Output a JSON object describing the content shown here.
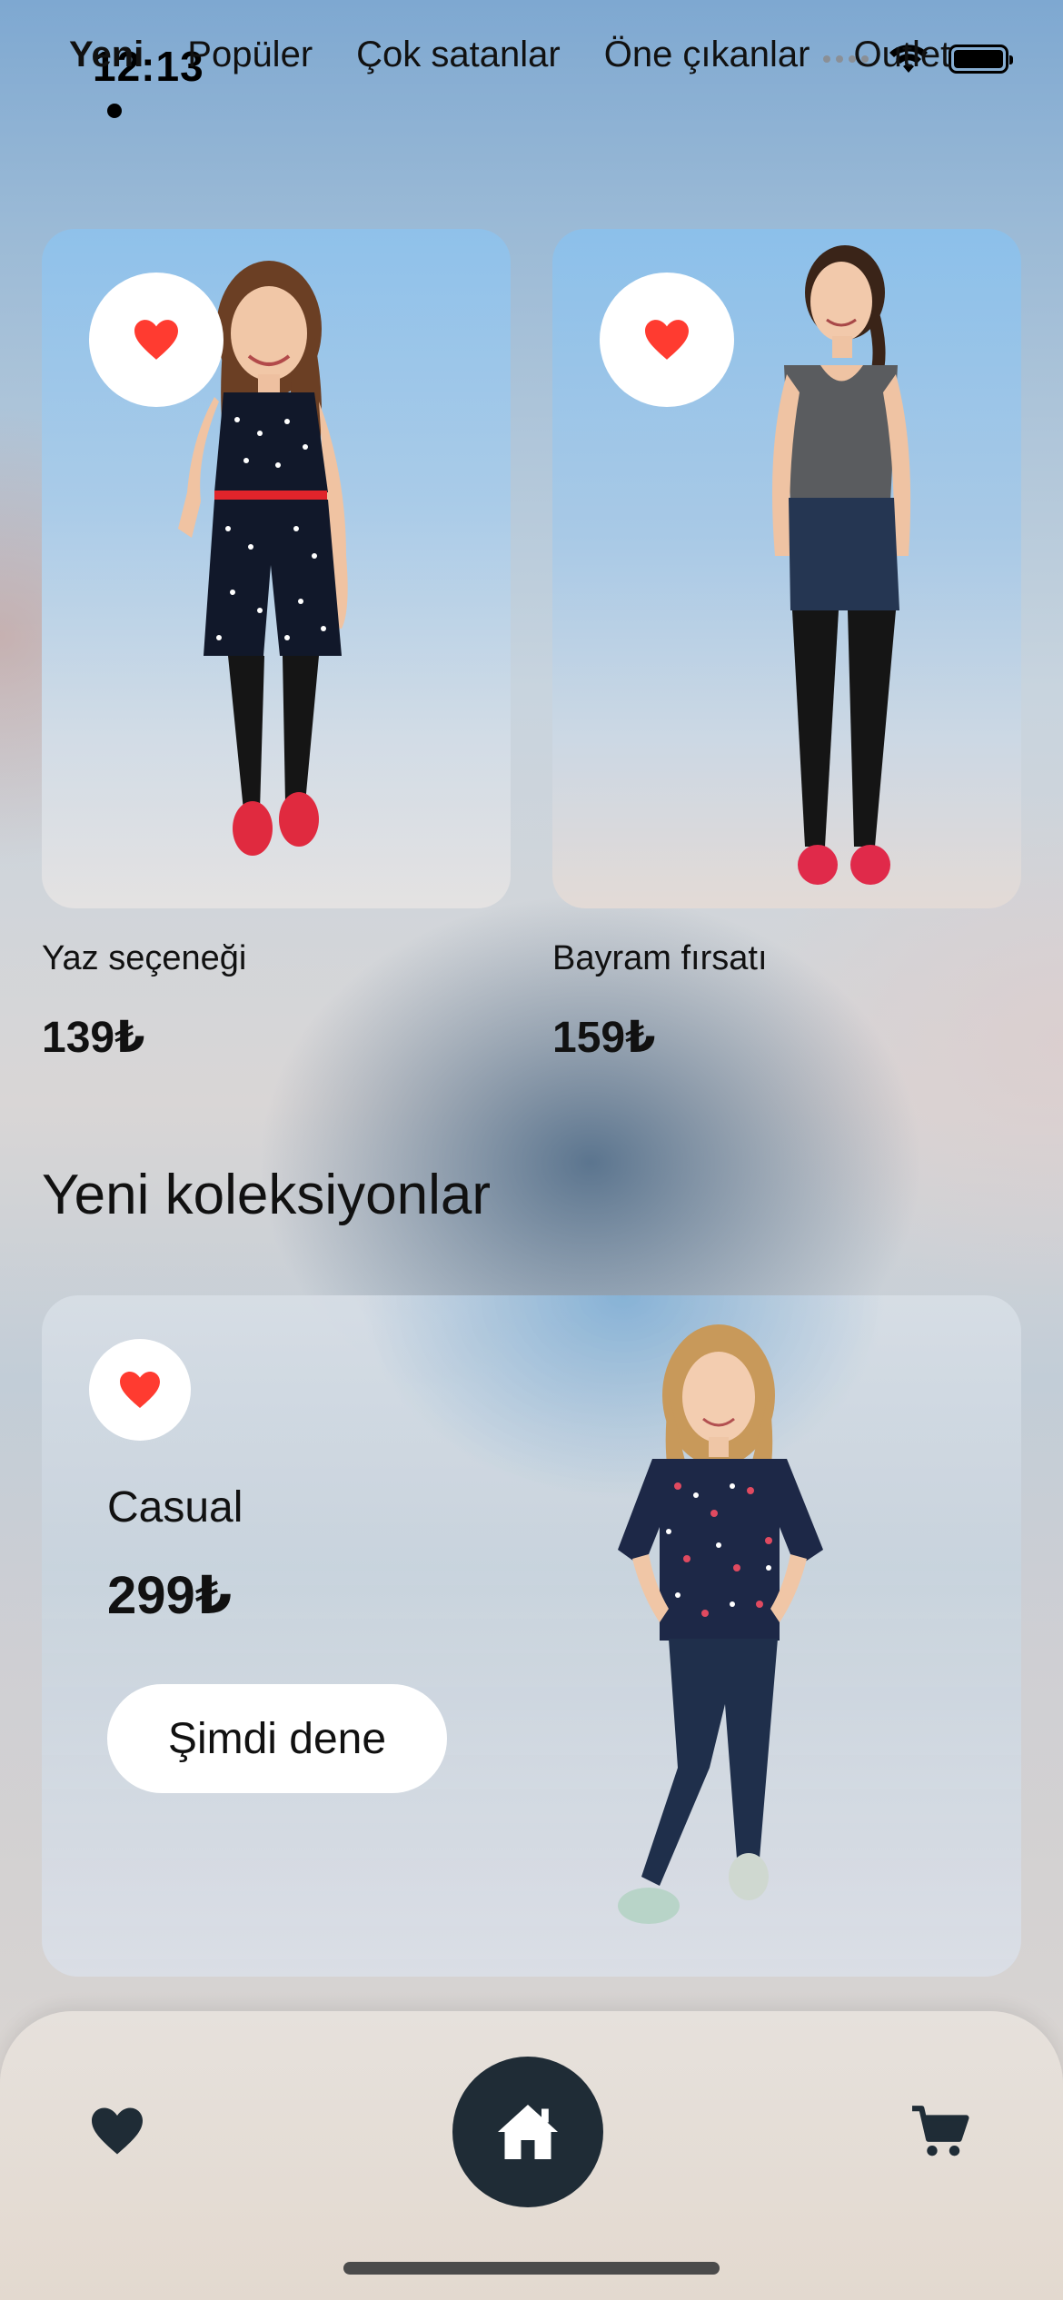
{
  "status_bar": {
    "time": "12:13"
  },
  "nav": {
    "tabs": [
      {
        "label": "Yeni",
        "active": true
      },
      {
        "label": "Popüler"
      },
      {
        "label": "Çok satanlar"
      },
      {
        "label": "Öne çıkanlar"
      },
      {
        "label": "Outlet"
      }
    ]
  },
  "products": [
    {
      "title": "Yaz seçeneği",
      "price": "139₺"
    },
    {
      "title": "Bayram fırsatı",
      "price": "159₺"
    }
  ],
  "section": {
    "title": "Yeni koleksiyonlar"
  },
  "collection": {
    "title": "Casual",
    "price": "299₺",
    "button_label": "Şimdi dene"
  },
  "bottom_nav": {
    "icons": [
      "heart-icon",
      "home-icon",
      "cart-icon"
    ]
  },
  "colors": {
    "heart": "#ff3b30",
    "home_button_bg": "#1f2c36",
    "text": "#111111"
  }
}
